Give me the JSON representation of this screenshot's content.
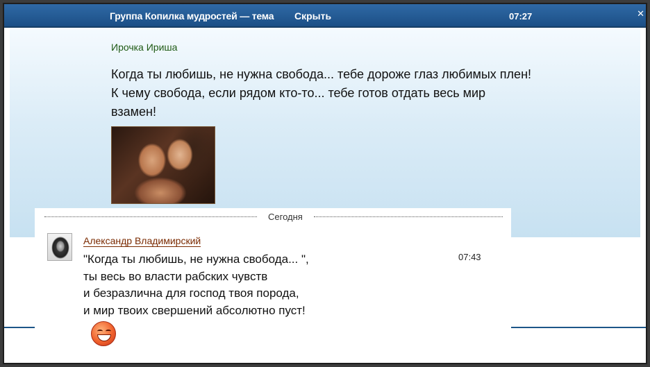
{
  "topbar": {
    "title": "Группа Копилка мудростей — тема",
    "hide_label": "Скрыть",
    "time": "07:27",
    "close_glyph": "✕"
  },
  "post": {
    "author": "Ирочка Ириша",
    "lines": [
      "Когда ты любишь, не нужна свобода... тебе дороже глаз любимых плен!",
      "К чему свобода, если рядом кто-то... тебе готов отдать весь мир",
      "взамен!"
    ],
    "photo_icon": "photo-couple"
  },
  "separator": {
    "label": "Сегодня"
  },
  "message": {
    "author": "Александр Владимирский",
    "time": "07:43",
    "lines": [
      "\"Когда ты любишь, не нужна свобода... \",",
      "ты весь во власти рабских чувств",
      "и безразлична для господ твоя порода,",
      "и мир твоих свершений абсолютно пуст!"
    ],
    "emoji_icon": "grinning-face-icon"
  },
  "colors": {
    "topbar": "#1f5a92",
    "post_author": "#1f5a14",
    "message_author": "#7a2a00"
  }
}
